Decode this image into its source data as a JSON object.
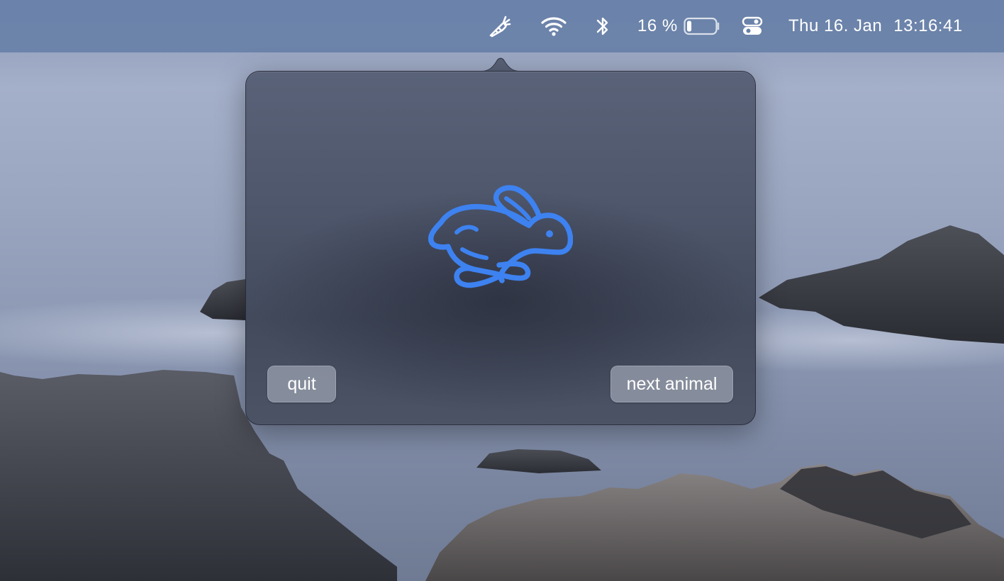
{
  "menubar": {
    "app_icon": "carrot-icon",
    "wifi_icon": "wifi-icon",
    "bluetooth_icon": "bluetooth-icon",
    "battery_percent_label": "16 %",
    "battery_level": 0.16,
    "battery_icon": "battery-icon",
    "control_center_icon": "control-center-icon",
    "date": "Thu 16. Jan",
    "time": "13:16:41"
  },
  "popover": {
    "animal_icon": "rabbit-icon",
    "accent_color": "#3d82f0",
    "quit_label": "quit",
    "next_label": "next animal"
  }
}
